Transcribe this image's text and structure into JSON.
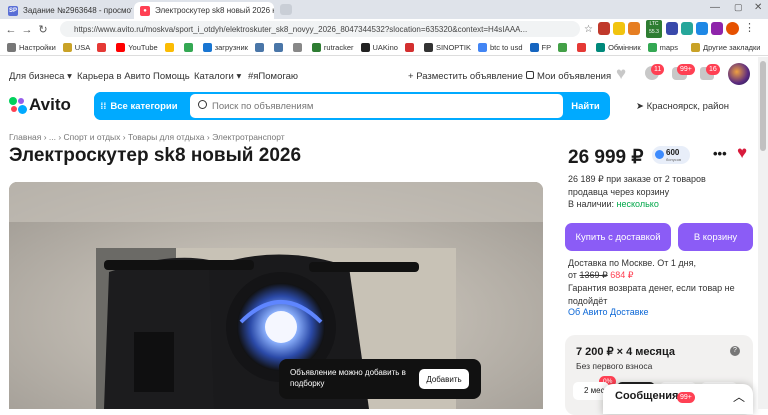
{
  "browser": {
    "tabs": [
      {
        "label": "Задание №2963648 - просмотр з",
        "active": false
      },
      {
        "label": "Электроскутер sk8 новый 2026 к",
        "active": true
      }
    ],
    "url": "https://www.avito.ru/moskva/sport_i_otdyh/elektroskuter_sk8_novyy_2026_8047344532?slocation=635320&context=H4sIAAA...",
    "bookmarks": [
      "Настройки",
      "USA",
      "YouTube",
      "загрузник",
      "rutracker",
      "UAKino",
      "SINOPTIK",
      "btc to usd",
      "FP",
      "Обмінник",
      "maps",
      "Другие закладки"
    ],
    "ext_badges": {
      "ltc": "LTC",
      "ltc_value": "55.3"
    }
  },
  "header": {
    "links": [
      "Для бизнеса",
      "Карьера в Авито",
      "Помощь",
      "Каталоги",
      "#яПомогаю"
    ],
    "post_ad": "Разместить объявление",
    "my_ads": "Мои объявления",
    "badges": {
      "bell": "11",
      "chat": "99+",
      "cart": "16"
    }
  },
  "brand": {
    "name": "Avito",
    "colors": {
      "accent": "#00aaff",
      "purple": "#8b5cf6",
      "green": "#02d15c",
      "red": "#ff4053"
    }
  },
  "search": {
    "categories_label": "Все категории",
    "placeholder": "Поиск по объявлениям",
    "find_label": "Найти",
    "location": "Красноярск, район"
  },
  "breadcrumb": "Главная › ... › Спорт и отдых › Товары для отдыха › Электротранспорт",
  "listing": {
    "title": "Электроскутер sk8 новый 2026",
    "price": "26 999 ₽",
    "rating_badge": {
      "value": "600",
      "caption": "бонусов"
    },
    "bulk_price_note": "26 189 ₽ при заказе от 2 товаров продавца через корзину",
    "in_stock_label": "В наличии:",
    "in_stock_value": "несколько",
    "buy_delivery_label": "Купить с доставкой",
    "to_cart_label": "В корзину",
    "delivery_line": "Доставка по Москве. От 1 дня,",
    "delivery_from": "от",
    "delivery_old_price": "1369 ₽",
    "delivery_new_price": "684 ₽",
    "guarantee": "Гарантия возврата денег, если товар не подойдёт",
    "avito_delivery_link": "Об Авито Доставке"
  },
  "credit": {
    "amount": "7 200 ₽ × 4 месяца",
    "subtitle": "Без первого взноса",
    "discount_badge": "0%",
    "term_label": "2 мес"
  },
  "toast": {
    "text": "Объявление можно добавить в подборку",
    "button": "Добавить"
  },
  "messages": {
    "label": "Сообщения",
    "badge": "99+"
  }
}
